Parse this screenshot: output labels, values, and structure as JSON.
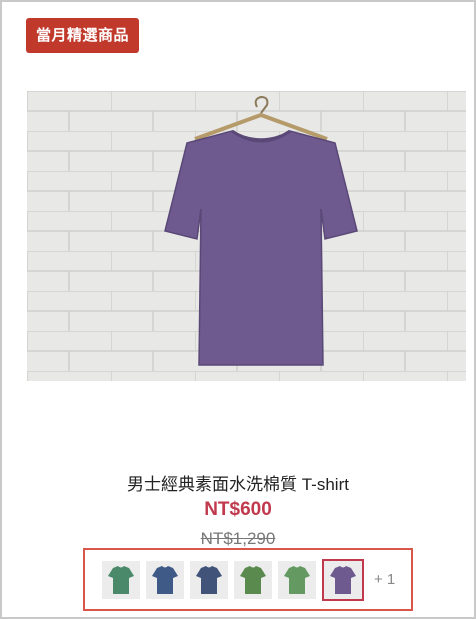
{
  "badge": "當月精選商品",
  "product": {
    "title": "男士經典素面水洗棉質 T-shirt",
    "price": "NT$600",
    "original_price": "NT$1,290",
    "image_color": "#6e5a8f"
  },
  "swatches": [
    {
      "name": "green",
      "color": "#4a8a6a",
      "selected": false
    },
    {
      "name": "navy",
      "color": "#3f5a86",
      "selected": false
    },
    {
      "name": "denim",
      "color": "#415379",
      "selected": false
    },
    {
      "name": "olive-green",
      "color": "#5b8a4f",
      "selected": false
    },
    {
      "name": "light-green",
      "color": "#649a62",
      "selected": false
    },
    {
      "name": "purple",
      "color": "#6e5a8f",
      "selected": true
    }
  ],
  "more_swatches": "+ 1"
}
